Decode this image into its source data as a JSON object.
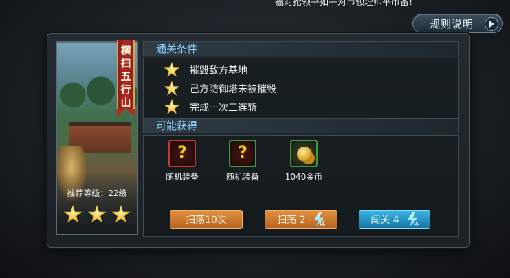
{
  "top_scroll_text": "福对抢领平如平对市领理师平市备!",
  "rules_button": {
    "label": "规则说明"
  },
  "stage": {
    "name_chars": [
      "横",
      "扫",
      "五",
      "行",
      "山"
    ],
    "recommended_level": "推荐等级：22级",
    "stars_earned": 3,
    "stars_total": 3
  },
  "conditions": {
    "title": "通关条件",
    "items": [
      "摧毁敌方基地",
      "己方防御塔未被摧毁",
      "完成一次三连斩"
    ]
  },
  "rewards": {
    "title": "可能获得",
    "items": [
      {
        "label": "随机装备",
        "icon": "random-equipment-icon",
        "rarity_color": "#c23a33"
      },
      {
        "label": "随机装备",
        "icon": "random-equipment-icon",
        "rarity_color": "#3a9c3f"
      },
      {
        "label": "1040金币",
        "icon": "gold-coins-icon",
        "rarity_color": "#3a9c3f"
      }
    ]
  },
  "buttons": {
    "sweep10": "扫荡10次",
    "sweep": "扫荡 2",
    "challenge": "闯关 4",
    "stamina_char": "体"
  },
  "colors": {
    "section_title": "#8fd0ff",
    "orange_button": "#e0913f",
    "blue_button": "#3ab7e6",
    "star": "#f2c033"
  }
}
